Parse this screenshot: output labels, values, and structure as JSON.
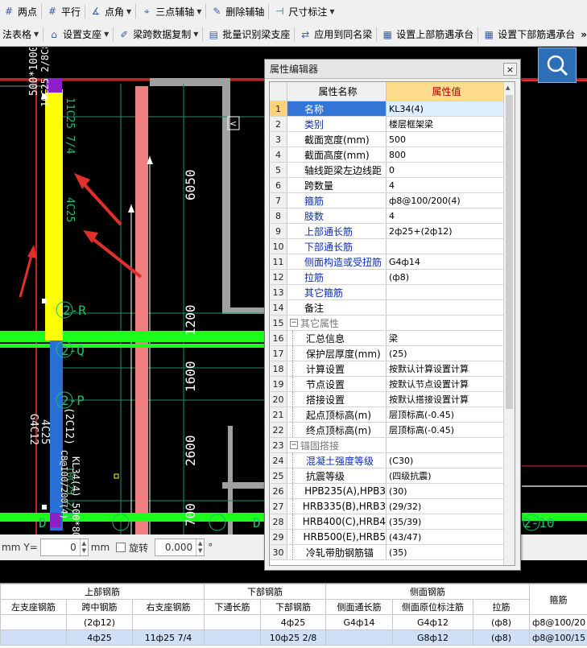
{
  "toolbar1": [
    {
      "name": "two-point-button",
      "icon": "two-point-axis-icon",
      "label": "两点",
      "caret": false
    },
    {
      "name": "parallel-button",
      "icon": "parallel-axis-icon",
      "label": "平行",
      "caret": false
    },
    {
      "name": "point-angle-button",
      "icon": "point-angle-icon",
      "label": "点角",
      "caret": true
    },
    {
      "name": "three-point-aux-button",
      "icon": "three-point-axis-icon",
      "label": "三点辅轴",
      "caret": true
    },
    {
      "name": "delete-aux-button",
      "icon": "delete-axis-icon",
      "label": "删除辅轴",
      "caret": false
    },
    {
      "name": "dimension-button",
      "icon": "dimension-icon",
      "label": "尺寸标注",
      "caret": true
    }
  ],
  "toolbar2": [
    {
      "name": "method-table-button",
      "icon": "",
      "label": "法表格",
      "caret": true
    },
    {
      "name": "set-support-button",
      "icon": "support-icon",
      "label": "设置支座",
      "caret": true
    },
    {
      "name": "span-copy-button",
      "icon": "brush-icon",
      "label": "梁跨数据复制",
      "caret": true
    },
    {
      "name": "batch-identify-button",
      "icon": "batch-icon",
      "label": "批量识别梁支座",
      "caret": false
    },
    {
      "name": "apply-same-name-button",
      "icon": "apply-icon",
      "label": "应用到同名梁",
      "caret": false
    },
    {
      "name": "set-top-bar-button",
      "icon": "top-bar-icon",
      "label": "设置上部筋遇承台",
      "caret": false
    },
    {
      "name": "set-bottom-bar-button",
      "icon": "bottom-bar-icon",
      "label": "设置下部筋遇承台",
      "caret": false
    }
  ],
  "toolbar_overflow": "»",
  "canvas": {
    "dims_right": [
      "6050",
      "1200",
      "1600",
      "2600",
      "700"
    ],
    "axis_labels": [
      "2-R",
      "2-Q",
      "2-P",
      "D",
      "D",
      "2-10"
    ],
    "beam_labels": [
      "11C25 7/4",
      "4C25",
      "10C25 2/8",
      "4C25",
      "G4C12",
      "(2C12)",
      "KL34(4) 500*800",
      "C8@100/200(4)"
    ],
    "beam_labels_rot": [
      "500*1000 G8C12",
      "10C25 2/8C8@100/150(4)"
    ]
  },
  "statusbar": {
    "mm1": "mm",
    "y_label": "Y=",
    "y_value": "0",
    "mm2": "mm",
    "rotate_label": "旋转",
    "rotate_value": "0.000",
    "degree": "°"
  },
  "property_editor": {
    "title": "属性编辑器",
    "close": "×",
    "col_name": "属性名称",
    "col_value": "属性值",
    "rows": [
      {
        "n": "1",
        "name": "名称",
        "value": "KL34(4)",
        "style": "blue",
        "selected": true
      },
      {
        "n": "2",
        "name": "类别",
        "value": "楼层框架梁",
        "style": "blue"
      },
      {
        "n": "3",
        "name": "截面宽度(mm)",
        "value": "500",
        "style": ""
      },
      {
        "n": "4",
        "name": "截面高度(mm)",
        "value": "800",
        "style": ""
      },
      {
        "n": "5",
        "name": "轴线距梁左边线距",
        "value": "0",
        "style": ""
      },
      {
        "n": "6",
        "name": "跨数量",
        "value": "4",
        "style": ""
      },
      {
        "n": "7",
        "name": "箍筋",
        "value": "ф8@100/200(4)",
        "style": "blue"
      },
      {
        "n": "8",
        "name": "肢数",
        "value": "4",
        "style": "blue"
      },
      {
        "n": "9",
        "name": "上部通长筋",
        "value": "2ф25+(2ф12)",
        "style": "blue"
      },
      {
        "n": "10",
        "name": "下部通长筋",
        "value": "",
        "style": "blue"
      },
      {
        "n": "11",
        "name": "侧面构造或受扭筋",
        "value": "G4ф14",
        "style": "blue"
      },
      {
        "n": "12",
        "name": "拉筋",
        "value": "(ф8)",
        "style": "blue"
      },
      {
        "n": "13",
        "name": "其它箍筋",
        "value": "",
        "style": "blue"
      },
      {
        "n": "14",
        "name": "备注",
        "value": "",
        "style": ""
      },
      {
        "n": "15",
        "name": "其它属性",
        "value": "",
        "style": "group"
      },
      {
        "n": "16",
        "name": "汇总信息",
        "value": "梁",
        "style": "child"
      },
      {
        "n": "17",
        "name": "保护层厚度(mm)",
        "value": "(25)",
        "style": "child"
      },
      {
        "n": "18",
        "name": "计算设置",
        "value": "按默认计算设置计算",
        "style": "child"
      },
      {
        "n": "19",
        "name": "节点设置",
        "value": "按默认节点设置计算",
        "style": "child"
      },
      {
        "n": "20",
        "name": "搭接设置",
        "value": "按默认搭接设置计算",
        "style": "child"
      },
      {
        "n": "21",
        "name": "起点顶标高(m)",
        "value": "层顶标高(-0.45)",
        "style": "child"
      },
      {
        "n": "22",
        "name": "终点顶标高(m)",
        "value": "层顶标高(-0.45)",
        "style": "child"
      },
      {
        "n": "23",
        "name": "锚固搭接",
        "value": "",
        "style": "group"
      },
      {
        "n": "24",
        "name": "混凝土强度等级",
        "value": "(C30)",
        "style": "childblue"
      },
      {
        "n": "25",
        "name": "抗震等级",
        "value": "(四级抗震)",
        "style": "child"
      },
      {
        "n": "26",
        "name": "HPB235(A),HPB3",
        "value": "(30)",
        "style": "child"
      },
      {
        "n": "27",
        "name": "HRB335(B),HRB3",
        "value": "(29/32)",
        "style": "child"
      },
      {
        "n": "28",
        "name": "HRB400(C),HRB4",
        "value": "(35/39)",
        "style": "child"
      },
      {
        "n": "29",
        "name": "HRB500(E),HRB5",
        "value": "(43/47)",
        "style": "child"
      },
      {
        "n": "30",
        "name": "冷轧带肋钢筋锚",
        "value": "(35)",
        "style": "child"
      }
    ]
  },
  "grid": {
    "group_headers": [
      "上部钢筋",
      "下部钢筋",
      "侧面钢筋",
      "箍筋"
    ],
    "sub_headers": [
      "左支座钢筋",
      "跨中钢筋",
      "右支座钢筋",
      "下通长筋",
      "下部钢筋",
      "侧面通长筋",
      "侧面原位标注筋",
      "拉筋"
    ],
    "rows": [
      {
        "cells": [
          "",
          "(2ф12)",
          "",
          "",
          "4ф25",
          "G4ф14",
          "G4ф12",
          "(ф8)",
          "ф8@100/20"
        ],
        "selected": false
      },
      {
        "cells": [
          "",
          "4ф25",
          "11ф25 7/4",
          "",
          "10ф25 2/8",
          "",
          "G8ф12",
          "(ф8)",
          "ф8@100/15"
        ],
        "selected": true
      }
    ]
  }
}
